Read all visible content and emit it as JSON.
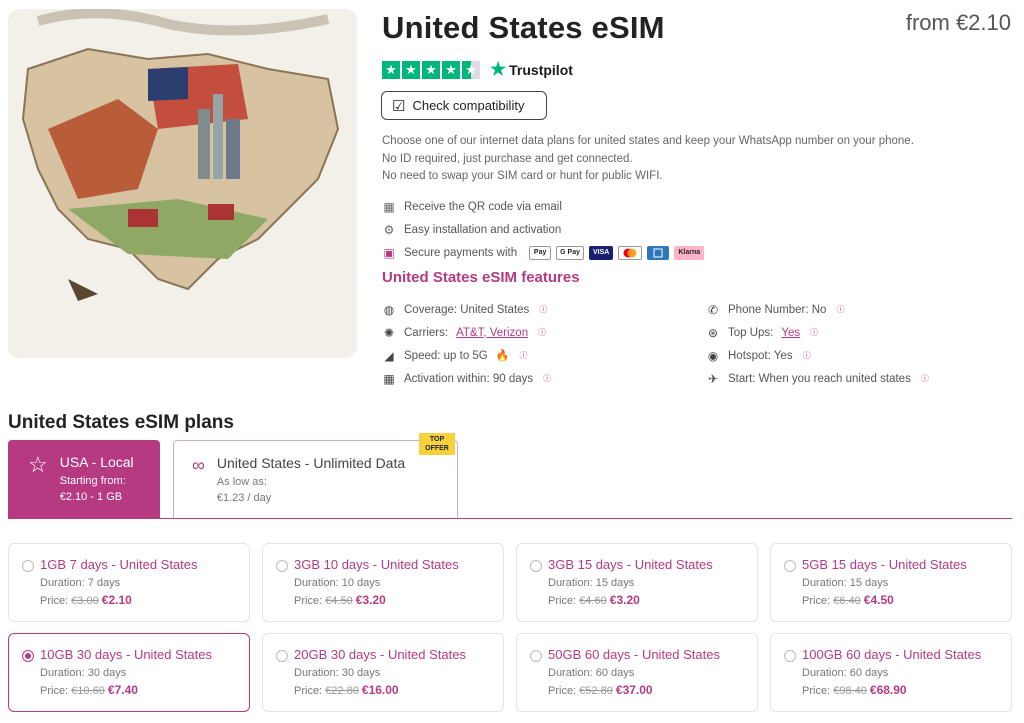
{
  "product": {
    "title": "United States eSIM",
    "price_from": "from €2.10"
  },
  "trustpilot": {
    "label": "Trustpilot",
    "rating_stars": 4.5
  },
  "compat_button": {
    "label": "Check compatibility"
  },
  "description": [
    "Choose one of our internet data plans for united states and keep your WhatsApp number on your phone.",
    "No ID required, just purchase and get connected.",
    "No need to swap your SIM card or hunt for public WIFI."
  ],
  "bullets": {
    "qr": "Receive the QR code via email",
    "install": "Easy installation and activation",
    "secure": "Secure payments with"
  },
  "payment_methods": [
    "Pay",
    "G Pay",
    "VISA",
    "",
    "",
    "Klarna"
  ],
  "features": {
    "title": "United States eSIM features",
    "coverage": "Coverage: United States",
    "carriers_label": "Carriers:",
    "carriers_value": "AT&T, Verizon",
    "speed": "Speed: up to 5G",
    "activation": "Activation within: 90 days",
    "phone": "Phone Number: No",
    "topups_label": "Top Ups:",
    "topups_value": "Yes",
    "hotspot": "Hotspot: Yes",
    "start": "Start: When you reach united states",
    "info_glyph": "ⓘ"
  },
  "plans": {
    "title": "United States eSIM plans",
    "tabs": [
      {
        "name": "USA - Local",
        "sub1": "Starting from:",
        "sub2": "€2.10 - 1 GB"
      },
      {
        "name": "United States - Unlimited Data",
        "sub1": "As low as:",
        "sub2": "€1.23 / day"
      }
    ],
    "badge_line1": "TOP",
    "badge_line2": "OFFER",
    "duration_label": "Duration:",
    "price_label": "Price:",
    "cards": [
      {
        "name": "1GB 7 days - United States",
        "duration": "7 days",
        "old": "€3.00",
        "new": "€2.10"
      },
      {
        "name": "3GB 10 days - United States",
        "duration": "10 days",
        "old": "€4.50",
        "new": "€3.20"
      },
      {
        "name": "3GB 15 days - United States",
        "duration": "15 days",
        "old": "€4.60",
        "new": "€3.20"
      },
      {
        "name": "5GB 15 days - United States",
        "duration": "15 days",
        "old": "€6.40",
        "new": "€4.50"
      },
      {
        "name": "10GB 30 days - United States",
        "duration": "30 days",
        "old": "€10.60",
        "new": "€7.40"
      },
      {
        "name": "20GB 30 days - United States",
        "duration": "30 days",
        "old": "€22.80",
        "new": "€16.00"
      },
      {
        "name": "50GB 60 days - United States",
        "duration": "60 days",
        "old": "€52.80",
        "new": "€37.00"
      },
      {
        "name": "100GB 60 days - United States",
        "duration": "60 days",
        "old": "€98.40",
        "new": "€68.90"
      }
    ],
    "selected_index": 4
  },
  "colors": {
    "accent": "#b53a82",
    "trustpilot_green": "#00b67a",
    "badge_yellow": "#f7d13b"
  }
}
